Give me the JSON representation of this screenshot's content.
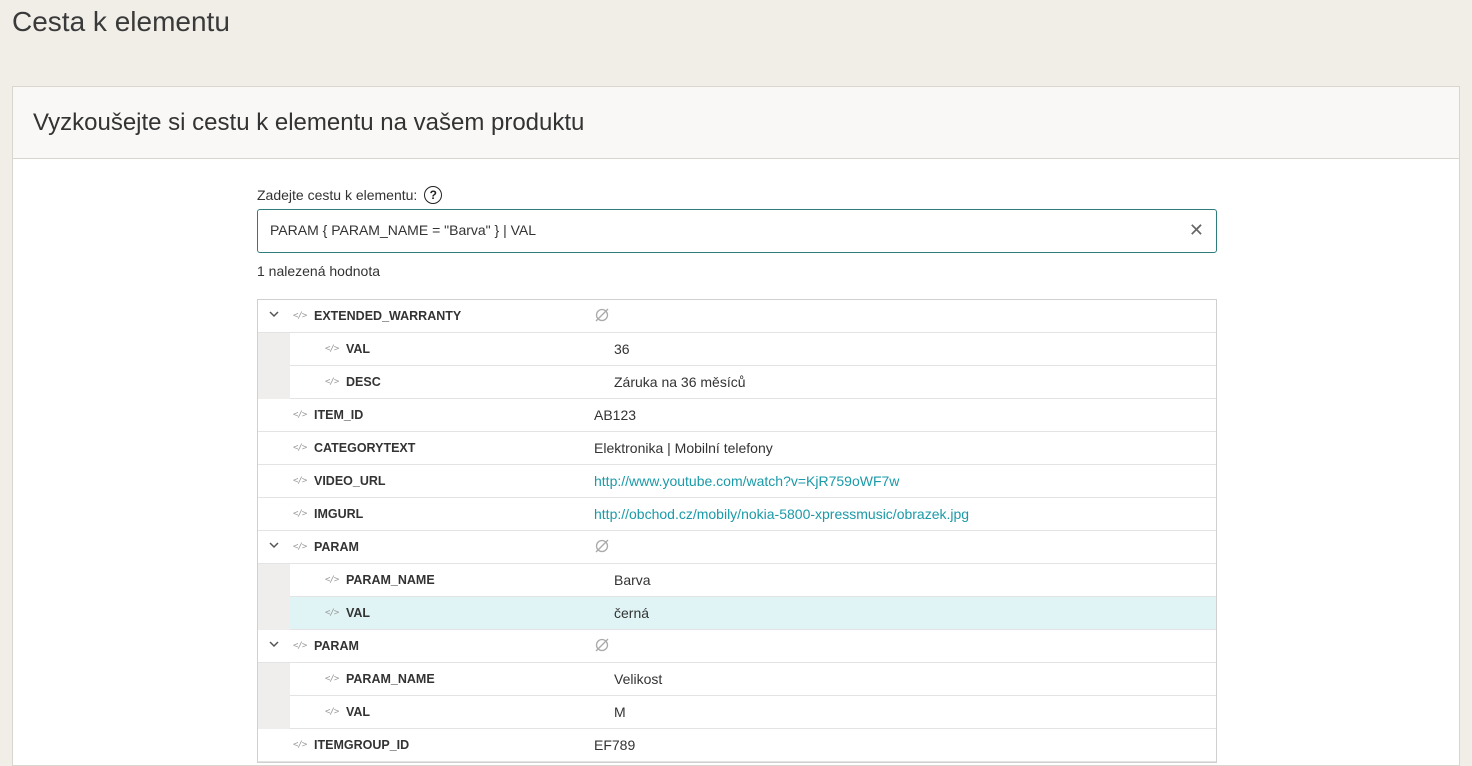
{
  "page": {
    "title": "Cesta k elementu"
  },
  "card": {
    "title": "Vyzkoušejte si cestu k elementu na vašem produktu"
  },
  "form": {
    "label": "Zadejte cestu k elementu:",
    "help_icon": "?",
    "path_value": "PARAM { PARAM_NAME = \"Barva\" } | VAL",
    "clear_icon": "✕",
    "result_count": "1 nalezená hodnota"
  },
  "tree": {
    "extended_warranty": {
      "name": "EXTENDED_WARRANTY",
      "children": [
        {
          "name": "VAL",
          "value": "36"
        },
        {
          "name": "DESC",
          "value": "Záruka na 36 měsíců"
        }
      ]
    },
    "item_id": {
      "name": "ITEM_ID",
      "value": "AB123"
    },
    "categorytext": {
      "name": "CATEGORYTEXT",
      "value": "Elektronika | Mobilní telefony"
    },
    "video_url": {
      "name": "VIDEO_URL",
      "value": "http://www.youtube.com/watch?v=KjR759oWF7w"
    },
    "imgurl": {
      "name": "IMGURL",
      "value": "http://obchod.cz/mobily/nokia-5800-xpressmusic/obrazek.jpg"
    },
    "param1": {
      "name": "PARAM",
      "children": [
        {
          "name": "PARAM_NAME",
          "value": "Barva"
        },
        {
          "name": "VAL",
          "value": "černá"
        }
      ]
    },
    "param2": {
      "name": "PARAM",
      "children": [
        {
          "name": "PARAM_NAME",
          "value": "Velikost"
        },
        {
          "name": "VAL",
          "value": "M"
        }
      ]
    },
    "itemgroup_id": {
      "name": "ITEMGROUP_ID",
      "value": "EF789"
    }
  },
  "icons": {
    "code": "</>",
    "chevron": "chevron-down-icon",
    "null": "empty-set-icon"
  },
  "colors": {
    "accent": "#2e7d7a",
    "link": "#1a9aa8",
    "highlight": "#e0f4f6"
  }
}
